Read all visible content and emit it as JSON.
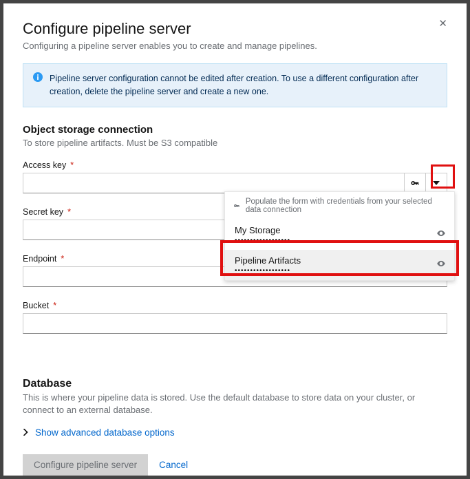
{
  "modal": {
    "title": "Configure pipeline server",
    "subtitle": "Configuring a pipeline server enables you to create and manage pipelines."
  },
  "info": {
    "text": "Pipeline server configuration cannot be edited after creation. To use a different configuration after creation, delete the pipeline server and create a new one."
  },
  "storage": {
    "heading": "Object storage connection",
    "sub": "To store pipeline artifacts. Must be S3 compatible",
    "fields": {
      "access_key_label": "Access key",
      "secret_key_label": "Secret key",
      "endpoint_label": "Endpoint",
      "bucket_label": "Bucket"
    }
  },
  "credentials_dropdown": {
    "description": "Populate the form with credentials from your selected data connection",
    "items": [
      {
        "name": "My Storage",
        "masked": "••••••••••••••••••"
      },
      {
        "name": "Pipeline Artifacts",
        "masked": "••••••••••••••••••"
      }
    ]
  },
  "database": {
    "heading": "Database",
    "sub": "This is where your pipeline data is stored. Use the default database to store data on your cluster, or connect to an external database.",
    "toggle_label": "Show advanced database options"
  },
  "footer": {
    "primary": "Configure pipeline server",
    "cancel": "Cancel"
  }
}
